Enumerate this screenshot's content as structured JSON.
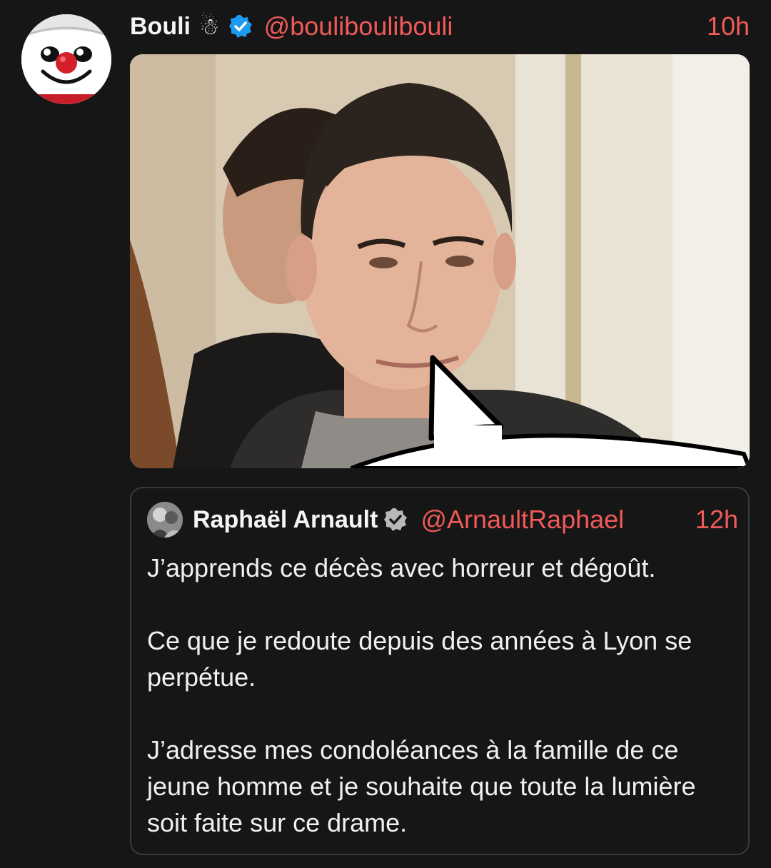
{
  "post": {
    "display_name": "Bouli",
    "name_emoji": "☃",
    "handle": "@boulibouliboulі",
    "time": "10h",
    "avatar_icon": "snowman-face-avatar",
    "verified_color": "#1d9bf0",
    "media_icon": "photo-man-with-speech-bubble"
  },
  "quote": {
    "display_name": "Raphaël Arnault",
    "handle": "@ArnaultRaphael",
    "time": "12h",
    "verified_color": "#b8b8b8",
    "paragraphs": [
      "J’apprends ce décès avec horreur et dégoût.",
      "Ce que je redoute depuis des années à Lyon se perpétue.",
      "J’adresse mes condoléances à la famille de ce jeune homme et je souhaite que toute la lumière soit faite sur ce drame."
    ]
  },
  "colors": {
    "background": "#161616",
    "accent": "#f05a58",
    "border": "#3a3a3a"
  }
}
